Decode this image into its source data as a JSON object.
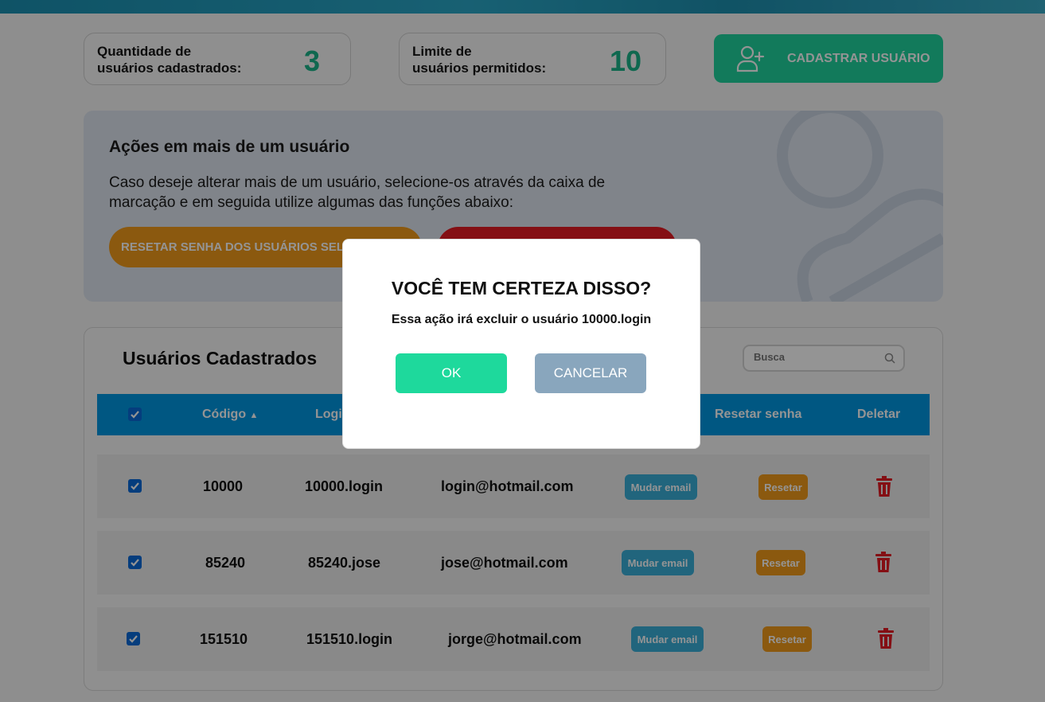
{
  "header": {
    "bar_color": "#1a8fb0"
  },
  "stats": {
    "quantidade": {
      "label": "Quantidade de\nusuários cadastrados:",
      "value": "3"
    },
    "limite": {
      "label": "Limite de\nusuários permitidos:",
      "value": "10"
    }
  },
  "cadastrar_button": {
    "label": "CADASTRAR USUÁRIO",
    "icon": "user-plus-icon"
  },
  "acoes": {
    "title": "Ações em mais de um usuário",
    "description": "Caso deseje alterar mais de um usuário, selecione-os através da caixa de marcação e em seguida utilize algumas das funções abaixo:",
    "reset_button": "RESETAR SENHA DOS USUÁRIOS SELE"
  },
  "table": {
    "title": "Usuários Cadastrados",
    "search_placeholder": "Busca",
    "columns": {
      "codigo": "Código",
      "login": "Login",
      "resetar_senha": "Resetar senha",
      "deletar": "Deletar"
    },
    "rows": [
      {
        "checked": true,
        "codigo": "10000",
        "login": "10000.login",
        "email": "login@hotmail.com",
        "mudar": "Mudar email",
        "resetar": "Resetar"
      },
      {
        "checked": true,
        "codigo": "85240",
        "login": "85240.jose",
        "email": "jose@hotmail.com",
        "mudar": "Mudar email",
        "resetar": "Resetar"
      },
      {
        "checked": true,
        "codigo": "151510",
        "login": "151510.login",
        "email": "jorge@hotmail.com",
        "mudar": "Mudar email",
        "resetar": "Resetar"
      }
    ]
  },
  "modal": {
    "title": "VOCÊ TEM CERTEZA DISSO?",
    "message": "Essa ação irá excluir o usuário 10000.login",
    "ok": "OK",
    "cancel": "CANCELAR"
  },
  "colors": {
    "accent_green": "#1fd29e",
    "header_blue": "#0096e0",
    "warn_orange": "#f09a1b",
    "danger_red": "#e31b23"
  }
}
